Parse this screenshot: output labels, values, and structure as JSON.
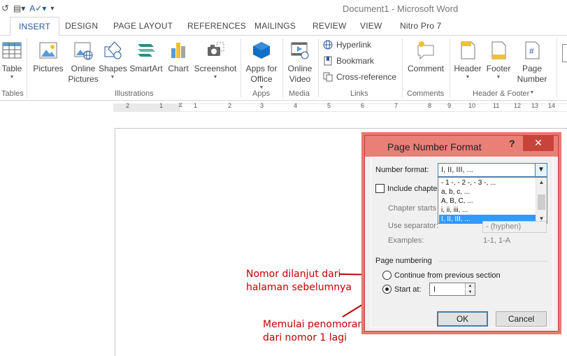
{
  "window": {
    "title": "Document1 - Microsoft Word"
  },
  "tabs": [
    {
      "label": "INSERT",
      "active": true
    },
    {
      "label": "DESIGN"
    },
    {
      "label": "PAGE LAYOUT"
    },
    {
      "label": "REFERENCES"
    },
    {
      "label": "MAILINGS"
    },
    {
      "label": "REVIEW"
    },
    {
      "label": "VIEW"
    },
    {
      "label": "Nitro Pro 7"
    }
  ],
  "ribbon": {
    "table": {
      "label": "Table"
    },
    "pictures": {
      "label": "Pictures"
    },
    "online_pictures": {
      "line1": "Online",
      "line2": "Pictures"
    },
    "shapes": {
      "label": "Shapes"
    },
    "smartart": {
      "label": "SmartArt"
    },
    "chart": {
      "label": "Chart"
    },
    "screenshot": {
      "label": "Screenshot"
    },
    "apps_for_office": {
      "line1": "Apps for",
      "line2": "Office"
    },
    "online_video": {
      "line1": "Online",
      "line2": "Video"
    },
    "hyperlink": {
      "label": "Hyperlink"
    },
    "bookmark": {
      "label": "Bookmark"
    },
    "cross_reference": {
      "label": "Cross-reference"
    },
    "comment": {
      "label": "Comment"
    },
    "header": {
      "label": "Header"
    },
    "footer": {
      "label": "Footer"
    },
    "page_number": {
      "line1": "Page",
      "line2": "Number"
    },
    "groups": {
      "tables": "Tables",
      "illustrations": "Illustrations",
      "apps": "Apps",
      "media": "Media",
      "links": "Links",
      "comments": "Comments",
      "header_footer": "Header & Footer"
    }
  },
  "ruler": {
    "numbers": [
      "2",
      "1",
      "1",
      "2",
      "3",
      "4",
      "5",
      "6",
      "7",
      "8",
      "9",
      "10",
      "11",
      "12",
      "13",
      "14"
    ]
  },
  "dialog": {
    "title": "Page Number Format",
    "help": "?",
    "close": "✕",
    "number_format_label": "Number format:",
    "number_format_value": "I, II, III, ...",
    "format_options": [
      "- 1 -, - 2 -, - 3 -, ...",
      "a, b, c, ...",
      "A, B, C, ...",
      "i, ii, iii, ...",
      "I, II, III, ..."
    ],
    "include_chapter_label": "Include chapte",
    "chapter_starts_label": "Chapter starts",
    "use_separator_label": "Use separator:",
    "separator_value": "-   (hyphen)",
    "examples_label": "Examples:",
    "examples_value": "1-1, 1-A",
    "page_numbering_label": "Page numbering",
    "continue_label": "Continue from previous section",
    "start_at_label": "Start at:",
    "start_at_value": "I",
    "ok": "OK",
    "cancel": "Cancel"
  },
  "annotations": {
    "continue_note_line1": "Nomor dilanjut dari",
    "continue_note_line2": "halaman sebelumnya",
    "start_note_line1": "Memulai penomoran",
    "start_note_line2": "dari nomor 1 lagi"
  },
  "colors": {
    "accent": "#2b579a",
    "dialog_frame": "#ea7f77",
    "annotation": "#c00000",
    "selection": "#3399ff"
  }
}
